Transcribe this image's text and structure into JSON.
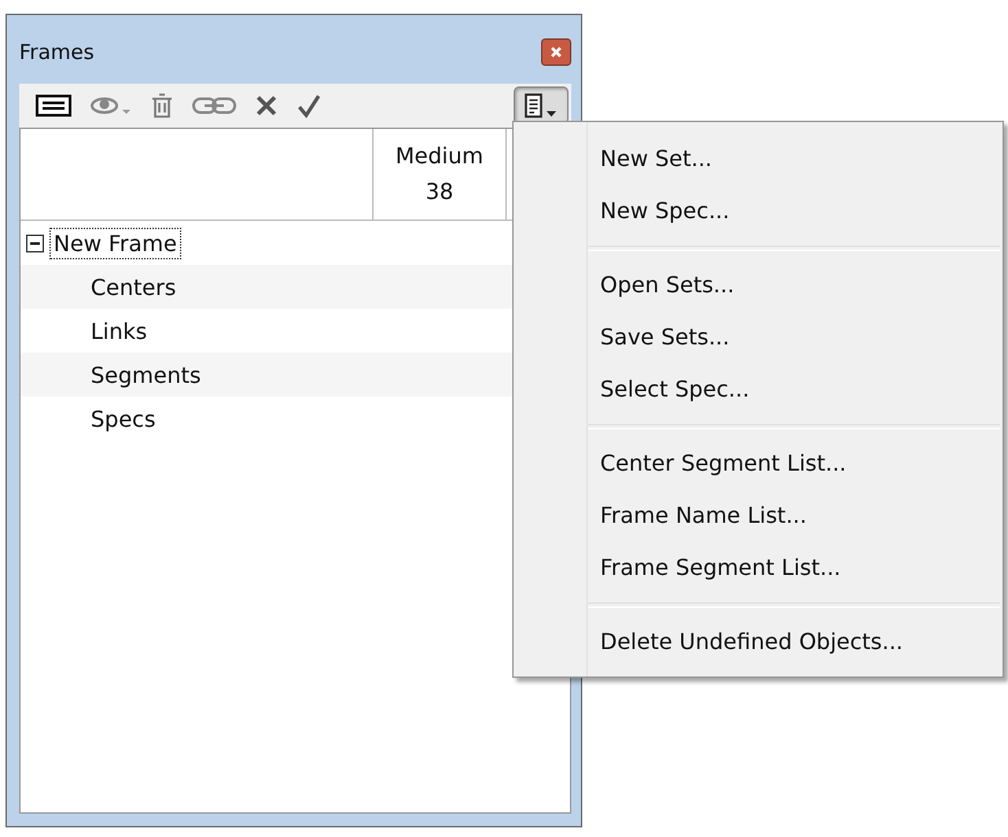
{
  "window": {
    "title": "Frames"
  },
  "toolbar": {
    "menu_button_pressed": true
  },
  "grid": {
    "columns": [
      {
        "name": "Medium",
        "value": "38"
      }
    ]
  },
  "tree": [
    {
      "label": "New Frame",
      "expanded": true,
      "focused": true,
      "children": [
        {
          "label": "Centers"
        },
        {
          "label": "Links"
        },
        {
          "label": "Segments"
        },
        {
          "label": "Specs"
        }
      ]
    }
  ],
  "menu": {
    "groups": [
      [
        "New Set...",
        "New Spec..."
      ],
      [
        "Open Sets...",
        "Save Sets...",
        "Select Spec..."
      ],
      [
        "Center Segment List...",
        "Frame Name List...",
        "Frame Segment List..."
      ],
      [
        "Delete Undefined Objects..."
      ]
    ]
  }
}
